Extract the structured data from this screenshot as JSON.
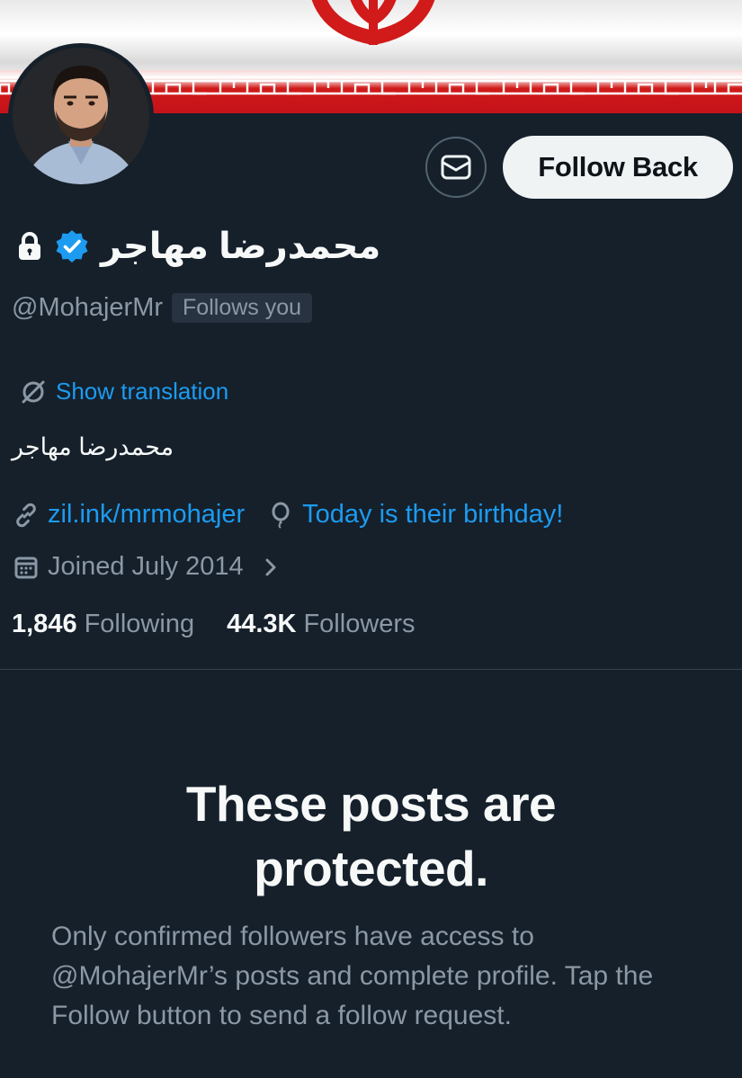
{
  "profile": {
    "display_name": "محمدرضا مهاجر",
    "handle": "@MohajerMr",
    "follows_you": "Follows you",
    "bio": "محمدرضا مهاجر",
    "show_translation": "Show translation",
    "link": "zil.ink/mrmohajer",
    "birthday": "Today is their birthday!",
    "joined": "Joined July 2014",
    "following_count": "1,846",
    "following_label": "Following",
    "followers_count": "44.3K",
    "followers_label": "Followers",
    "verified_color": "#1d9bf0",
    "locked": true
  },
  "actions": {
    "follow_back_label": "Follow Back",
    "message_icon": "envelope-icon"
  },
  "protected": {
    "title": "These posts are protected.",
    "body": "Only confirmed followers have access to @MohajerMr’s posts and complete profile. Tap the Follow button to send a follow request."
  },
  "theme": {
    "background": "#15202b",
    "accent": "#1d9bf0",
    "muted": "#8b98a5"
  }
}
